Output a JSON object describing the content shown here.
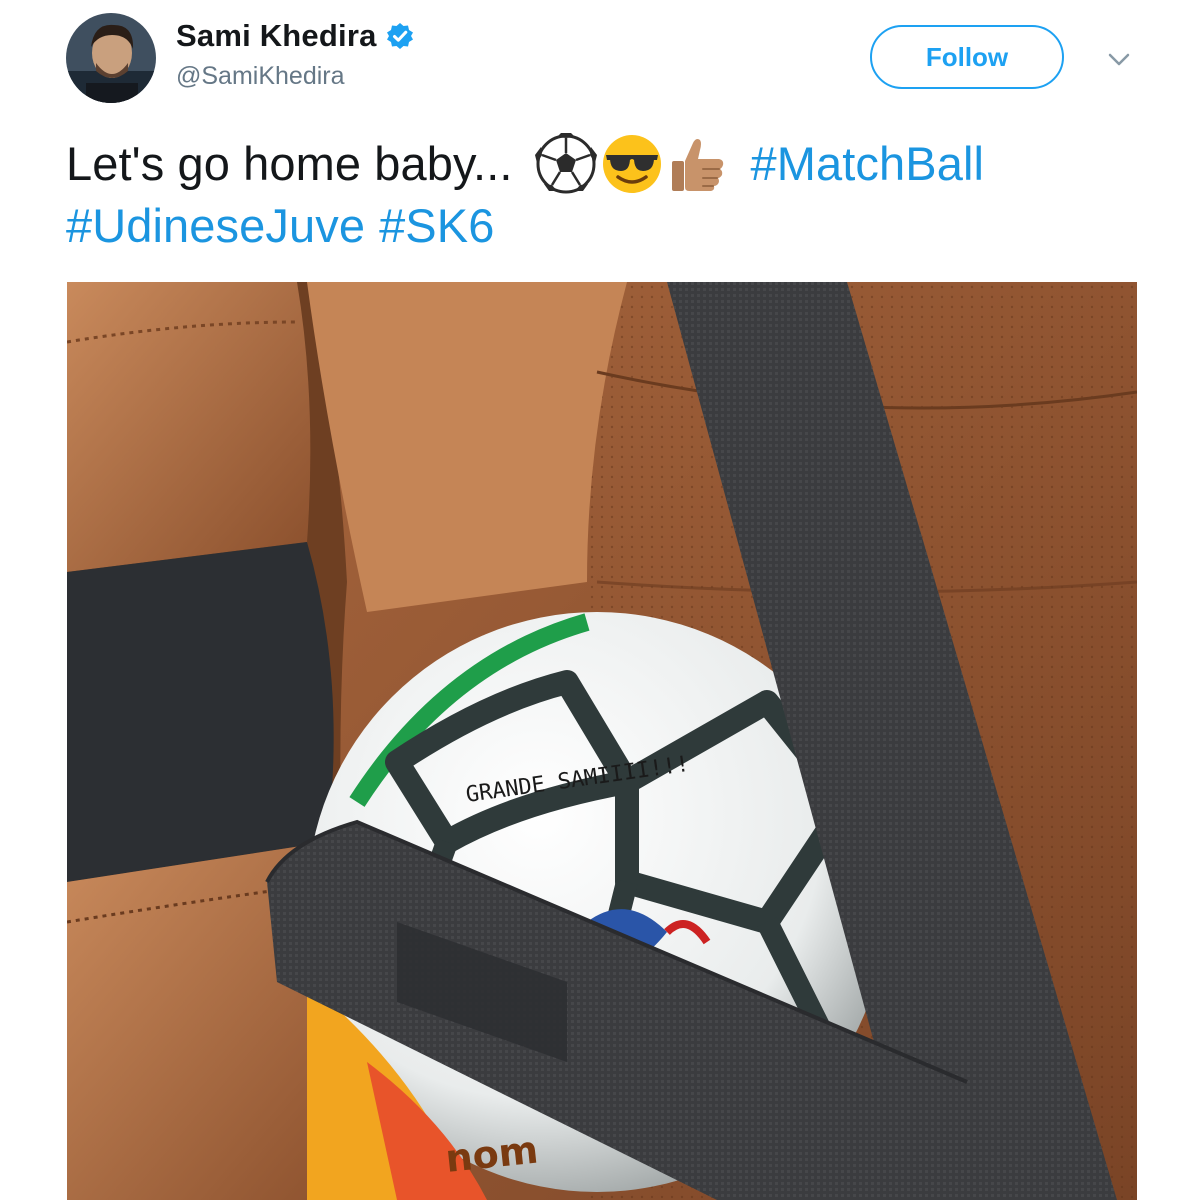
{
  "tweet": {
    "author": {
      "display_name": "Sami Khedira",
      "handle": "@SamiKhedira",
      "verified": true,
      "avatar": "avatar-photo"
    },
    "follow_label": "Follow",
    "text_plain": "Let's go home baby...",
    "emojis": [
      "soccer-ball-emoji",
      "sunglasses-face-emoji",
      "thumbs-up-emoji"
    ],
    "hashtags": [
      "#MatchBall",
      "#UdineseJuve",
      "#SK6"
    ],
    "media": {
      "ball_signature_text": "GRANDE SAMIIII!!!",
      "ball_brand_text": "nom"
    }
  },
  "colors": {
    "accent": "#1da1f2",
    "hashtag": "#1b95e0",
    "text": "#14171a",
    "secondary_text": "#657786",
    "leather": "#a8683f",
    "seatbelt": "#3c3d40"
  }
}
